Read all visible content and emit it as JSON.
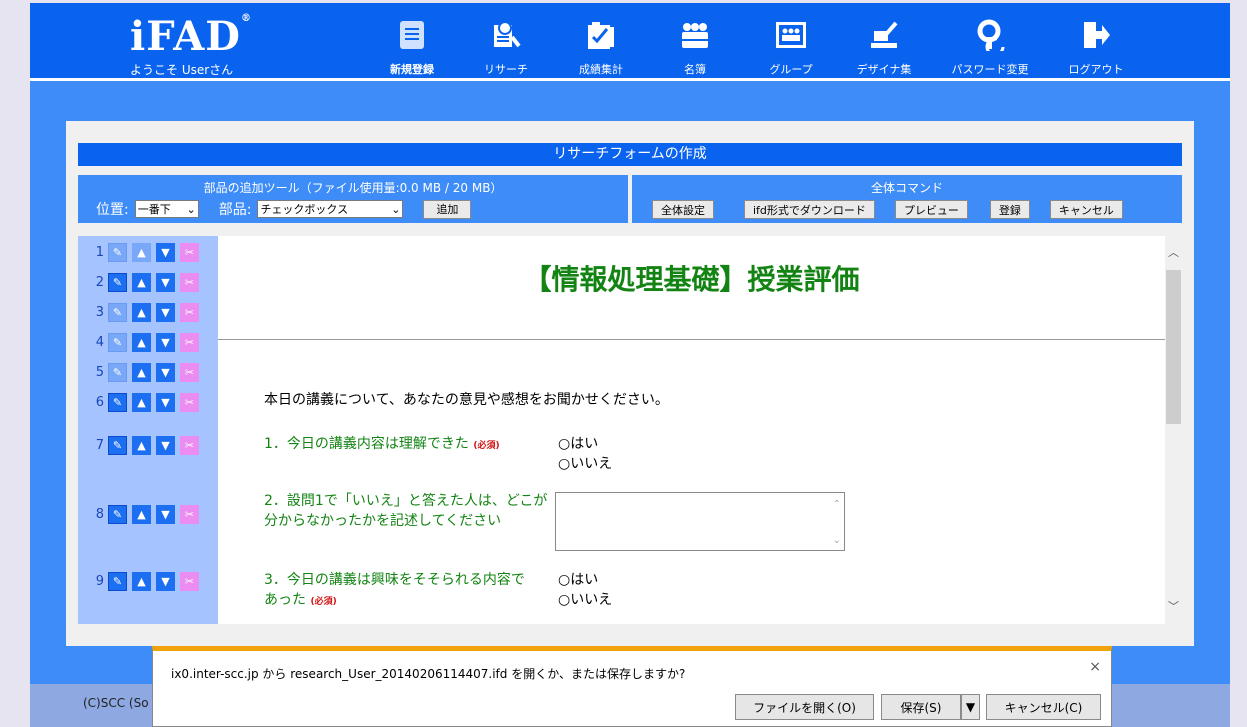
{
  "header": {
    "logo": "iFAD",
    "logo_mark": "®",
    "welcome": "ようこそ Userさん",
    "nav": [
      {
        "label": "新規登録",
        "icon": "document-icon",
        "active": true
      },
      {
        "label": "リサーチ",
        "icon": "research-icon"
      },
      {
        "label": "成績集計",
        "icon": "grades-icon"
      },
      {
        "label": "名簿",
        "icon": "roster-icon"
      },
      {
        "label": "グループ",
        "icon": "group-icon"
      },
      {
        "label": "デザイナ集",
        "icon": "designer-icon"
      },
      {
        "label": "パスワード変更",
        "icon": "password-icon"
      },
      {
        "label": "ログアウト",
        "icon": "logout-icon"
      }
    ]
  },
  "page": {
    "title": "リサーチフォームの作成",
    "tools": {
      "title": "部品の追加ツール（ファイル使用量:0.0 MB / 20 MB）",
      "position_label": "位置:",
      "position_value": "一番下",
      "part_label": "部品:",
      "part_value": "チェックボックス",
      "add_label": "追加"
    },
    "commands": {
      "title": "全体コマンド",
      "buttons": [
        "全体設定",
        "ifd形式でダウンロード",
        "プレビュー",
        "登録",
        "キャンセル"
      ]
    },
    "row_numbers": [
      "1",
      "2",
      "3",
      "4",
      "5",
      "6",
      "7",
      "8",
      "9"
    ]
  },
  "form": {
    "heading": "【情報処理基礎】授業評価",
    "intro": "本日の講義について、あなたの意見や感想をお聞かせください。",
    "q1": "1．今日の講義内容は理解できた",
    "q1_req": "(必須)",
    "q1_opts": [
      "○はい",
      "○いいえ"
    ],
    "q2_line1": "2．設問1で「いいえ」と答えた人は、どこが",
    "q2_line2": "分からなかったかを記述してください",
    "q3_line1": "3．今日の講義は興味をそそられる内容で",
    "q3_line2": "あった",
    "q3_req": "(必須)",
    "q3_opts": [
      "○はい",
      "○いいえ"
    ]
  },
  "footer": {
    "copyright": "(C)SCC (So"
  },
  "download_bar": {
    "message": "ix0.inter-scc.jp から research_User_20140206114407.ifd を開くか、または保存しますか?",
    "open_label": "ファイルを開く(O)",
    "save_label": "保存(S)",
    "cancel_label": "キャンセル(C)",
    "close": "×"
  },
  "colors": {
    "brand": "#0a63ef",
    "accent": "#3d8cf7",
    "question": "#138413",
    "required": "#d21414",
    "notification": "#f0a30a"
  }
}
